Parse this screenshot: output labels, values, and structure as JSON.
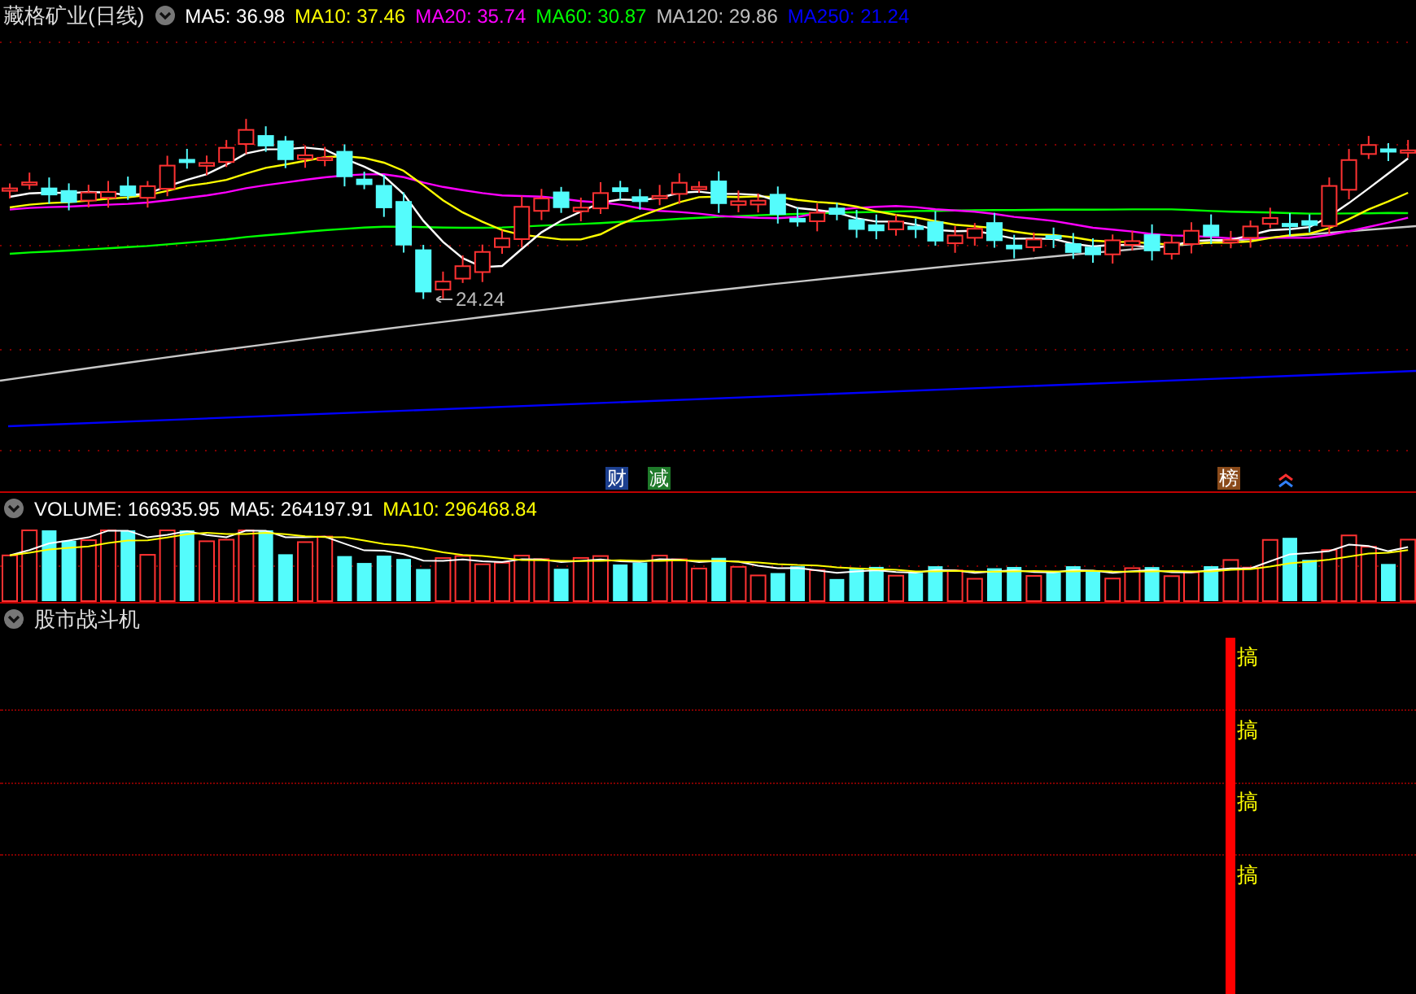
{
  "header": {
    "title": "藏格矿业(日线)",
    "averages": [
      {
        "label": "MA5: 36.98",
        "color": "#ffffff"
      },
      {
        "label": "MA10: 37.46",
        "color": "#ffff00"
      },
      {
        "label": "MA20: 35.74",
        "color": "#ff00ff"
      },
      {
        "label": "MA60: 30.87",
        "color": "#00ff00"
      },
      {
        "label": "MA120: 29.86",
        "color": "#c0c0c0"
      },
      {
        "label": "MA250: 21.24",
        "color": "#0000ff"
      }
    ]
  },
  "main_chart": {
    "low_label": "24.24",
    "markers": [
      {
        "text": "财",
        "color": "#1c3f8f"
      },
      {
        "text": "减",
        "color": "#1f7a2a"
      },
      {
        "text": "榜",
        "color": "#8a4a1a"
      }
    ]
  },
  "volume": {
    "readings": [
      {
        "label": "VOLUME: 166935.95",
        "color": "#ffffff"
      },
      {
        "label": "MA5: 264197.91",
        "color": "#ffffff"
      },
      {
        "label": "MA10: 296468.84",
        "color": "#ffff00"
      }
    ]
  },
  "indicator": {
    "title": "股市战斗机",
    "signals": [
      "搞",
      "搞",
      "搞",
      "搞"
    ]
  }
}
